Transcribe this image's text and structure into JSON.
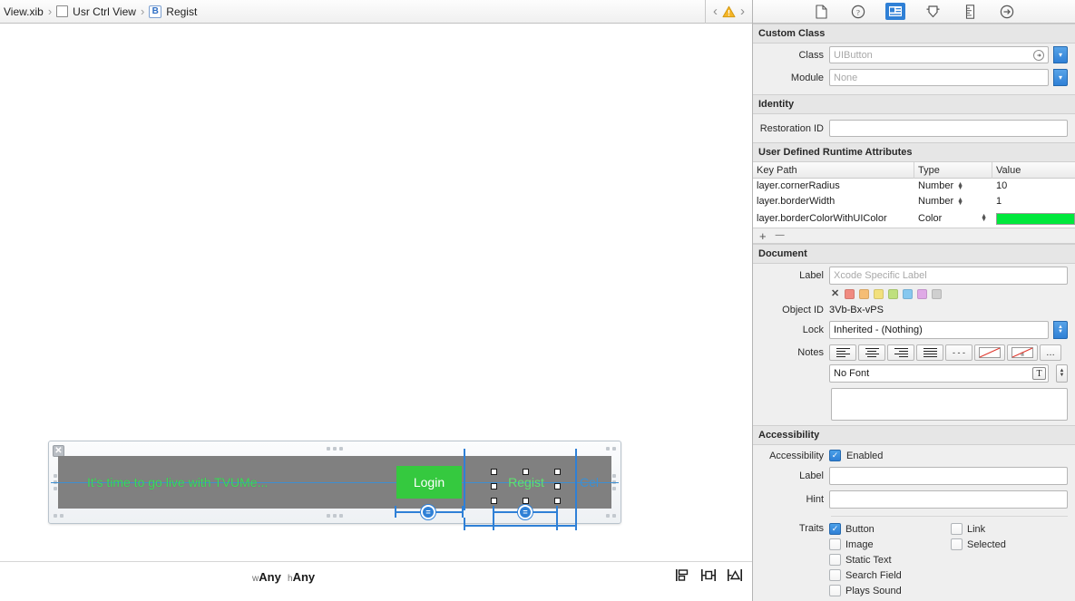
{
  "jumpbar": {
    "crumbs": [
      {
        "label": "View.xib",
        "icon": "none"
      },
      {
        "label": "Usr Ctrl View",
        "icon": "xib-square-icon"
      },
      {
        "label": "Regist",
        "icon": "button-object-icon"
      }
    ],
    "back_label": "‹",
    "forward_label": "›",
    "warning_icon": "warning-triangle-icon"
  },
  "inspector_tabs": [
    {
      "name": "file-inspector-tab",
      "icon": "document-icon",
      "active": false
    },
    {
      "name": "quick-help-tab",
      "icon": "question-circle-icon",
      "active": false
    },
    {
      "name": "identity-inspector-tab",
      "icon": "identity-card-icon",
      "active": true
    },
    {
      "name": "attributes-inspector-tab",
      "icon": "attributes-slider-icon",
      "active": false
    },
    {
      "name": "size-inspector-tab",
      "icon": "ruler-icon",
      "active": false
    },
    {
      "name": "connections-inspector-tab",
      "icon": "arrow-circle-icon",
      "active": false
    }
  ],
  "custom_class": {
    "header": "Custom Class",
    "class_label": "Class",
    "class_value": "UIButton",
    "module_label": "Module",
    "module_value": "None"
  },
  "identity": {
    "header": "Identity",
    "restoration_id_label": "Restoration ID",
    "restoration_id_value": ""
  },
  "runtime_attributes": {
    "header": "User Defined Runtime Attributes",
    "columns": [
      "Key Path",
      "Type",
      "Value"
    ],
    "rows": [
      {
        "key_path": "layer.cornerRadius",
        "type": "Number",
        "value": "10",
        "value_kind": "text"
      },
      {
        "key_path": "layer.borderWidth",
        "type": "Number",
        "value": "1",
        "value_kind": "text"
      },
      {
        "key_path": "layer.borderColorWithUIColor",
        "type": "Color",
        "value": "#00E83C",
        "value_kind": "color"
      }
    ],
    "add_label": "+",
    "remove_label": "—"
  },
  "document": {
    "header": "Document",
    "label_label": "Label",
    "label_placeholder": "Xcode Specific Label",
    "label_value": "",
    "swatches": [
      "none",
      "#f08a80",
      "#f5bd74",
      "#f2e07c",
      "#bfe07e",
      "#86c8ef",
      "#dfa9e6",
      "#cfcfcf"
    ],
    "swatch_none_label": "✕",
    "object_id_label": "Object ID",
    "object_id_value": "3Vb-Bx-vPS",
    "lock_label": "Lock",
    "lock_value": "Inherited - (Nothing)",
    "notes_label": "Notes",
    "notes_buttons": [
      "align-left-icon",
      "align-center-icon",
      "align-right-icon",
      "align-justify-icon",
      "dashes-icon",
      "text-color-none-icon",
      "background-color-none-icon",
      "more-options-icon"
    ],
    "notes_more_label": "…",
    "notes_dashes_label": "- - -",
    "font_placeholder": "No Font",
    "font_value": "",
    "notes_text": ""
  },
  "accessibility": {
    "header": "Accessibility",
    "accessibility_label": "Accessibility",
    "enabled_label": "Enabled",
    "enabled_checked": true,
    "label_label": "Label",
    "label_value": "",
    "hint_label": "Hint",
    "hint_value": "",
    "traits_label": "Traits",
    "traits_col1": [
      {
        "label": "Button",
        "checked": true
      },
      {
        "label": "Image",
        "checked": false
      },
      {
        "label": "Static Text",
        "checked": false
      },
      {
        "label": "Search Field",
        "checked": false
      },
      {
        "label": "Plays Sound",
        "checked": false
      }
    ],
    "traits_col2": [
      {
        "label": "Link",
        "checked": false
      },
      {
        "label": "Selected",
        "checked": false
      }
    ]
  },
  "canvas": {
    "close_label": "✕",
    "headline_text": "It's time to go live with TVUMe...",
    "login_label": "Login",
    "regist_label": "Regist",
    "cel_label": "Cel",
    "constraint_badge_label": "=",
    "view_background": "#808080",
    "login_fill": "#35C93F",
    "headline_color": "#3DDB5B",
    "regist_color": "#5DE36F",
    "cel_color": "#3D8FD1"
  },
  "canvas_bottom": {
    "size_class_w_prefix": "w",
    "size_class_w": "Any",
    "size_class_h_prefix": "h",
    "size_class_h": "Any",
    "autolayout_buttons": [
      "align-button",
      "pin-button",
      "resolve-issues-button"
    ]
  }
}
